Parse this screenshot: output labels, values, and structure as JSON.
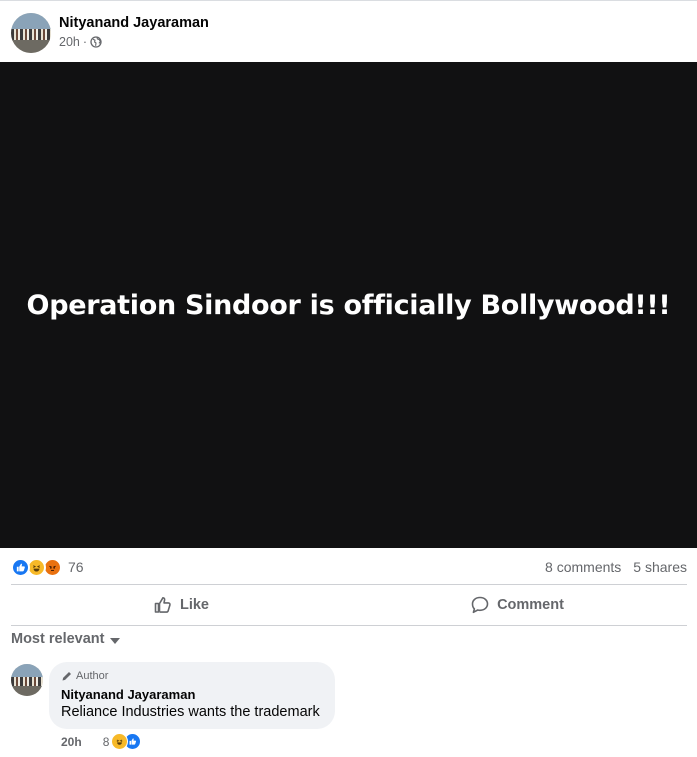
{
  "post": {
    "author": "Nityanand Jayaraman",
    "time": "20h",
    "separator": "·",
    "audience_icon": "globe-icon",
    "image_text": "Operation Sindoor is officially Bollywood!!!"
  },
  "stats": {
    "reaction_icons": [
      "like-icon",
      "haha-icon",
      "angry-icon"
    ],
    "reaction_count": "76",
    "comments": "8 comments",
    "shares": "5 shares"
  },
  "actions": {
    "like_label": "Like",
    "comment_label": "Comment"
  },
  "sort": {
    "label": "Most relevant"
  },
  "comment": {
    "badge": "Author",
    "name": "Nityanand Jayaraman",
    "text": "Reliance Industries wants the trademark",
    "time": "20h",
    "reaction_count": "8",
    "reaction_icons": [
      "haha-icon",
      "like-icon"
    ]
  },
  "colors": {
    "like_blue": "#1877f2",
    "haha_yellow": "#f7b928",
    "angry_orange": "#e9710f",
    "secondary_text": "#65676b",
    "image_bg": "#111112"
  }
}
